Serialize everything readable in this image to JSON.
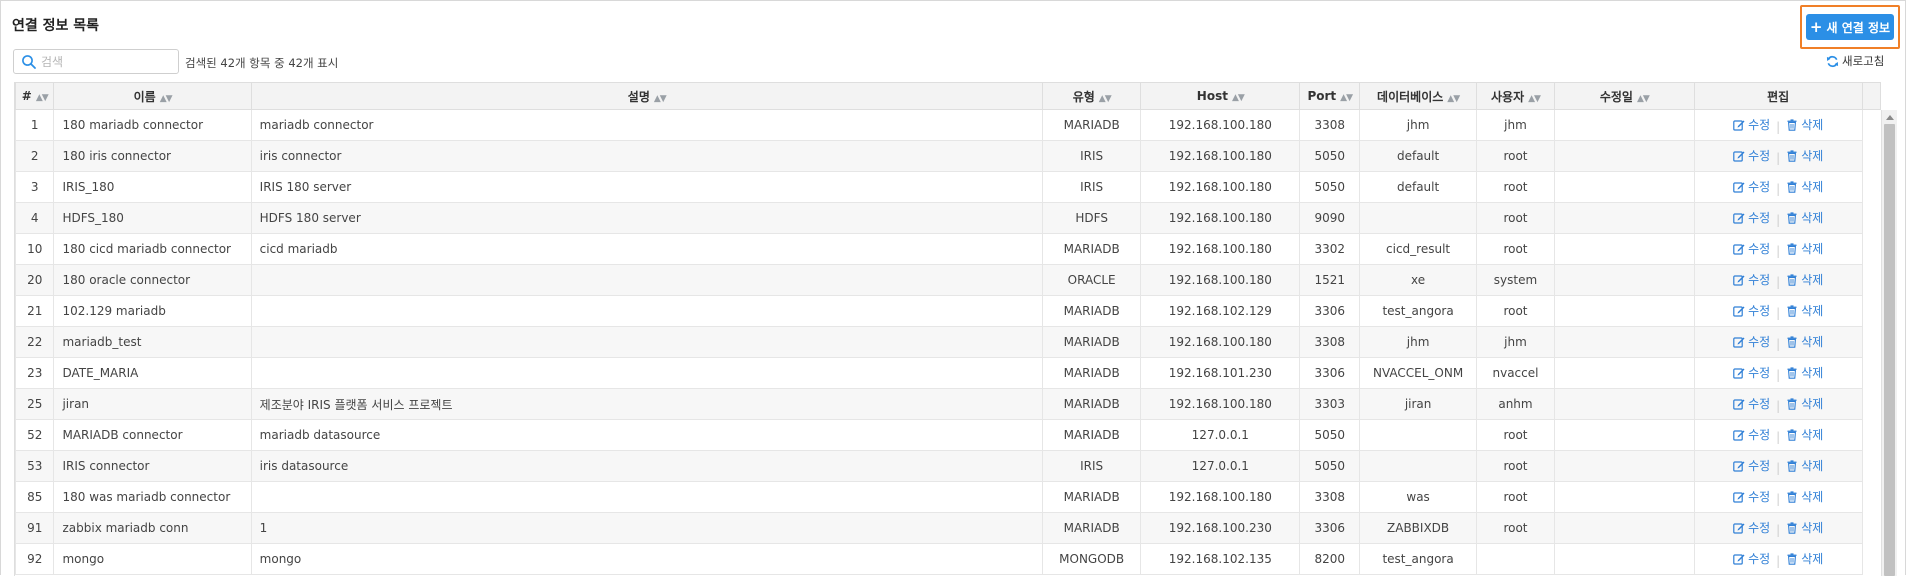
{
  "header": {
    "title": "연결 정보 목록",
    "new_button_label": "새 연결 정보"
  },
  "search": {
    "placeholder": "검색",
    "value": "",
    "result_text": "검색된 42개 항목 중 42개 표시"
  },
  "refresh_label": "새로고침",
  "colors": {
    "accent": "#2b8fe6",
    "highlight_border": "#f07f27",
    "link": "#2f7fd6"
  },
  "table": {
    "columns": [
      "#",
      "이름",
      "설명",
      "유형",
      "Host",
      "Port",
      "데이터베이스",
      "사용자",
      "수정일",
      "편집"
    ],
    "edit_label": "수정",
    "delete_label": "삭제",
    "rows": [
      {
        "id": "1",
        "name": "180 mariadb connector",
        "desc": "mariadb connector",
        "type": "MARIADB",
        "host": "192.168.100.180",
        "port": "3308",
        "db": "jhm",
        "user": "jhm",
        "modified": ""
      },
      {
        "id": "2",
        "name": "180 iris connector",
        "desc": "iris connector",
        "type": "IRIS",
        "host": "192.168.100.180",
        "port": "5050",
        "db": "default",
        "user": "root",
        "modified": ""
      },
      {
        "id": "3",
        "name": "IRIS_180",
        "desc": "IRIS 180 server",
        "type": "IRIS",
        "host": "192.168.100.180",
        "port": "5050",
        "db": "default",
        "user": "root",
        "modified": ""
      },
      {
        "id": "4",
        "name": "HDFS_180",
        "desc": "HDFS 180 server",
        "type": "HDFS",
        "host": "192.168.100.180",
        "port": "9090",
        "db": "",
        "user": "root",
        "modified": ""
      },
      {
        "id": "10",
        "name": "180 cicd mariadb connector",
        "desc": "cicd mariadb",
        "type": "MARIADB",
        "host": "192.168.100.180",
        "port": "3302",
        "db": "cicd_result",
        "user": "root",
        "modified": ""
      },
      {
        "id": "20",
        "name": "180 oracle connector",
        "desc": "",
        "type": "ORACLE",
        "host": "192.168.100.180",
        "port": "1521",
        "db": "xe",
        "user": "system",
        "modified": ""
      },
      {
        "id": "21",
        "name": "102.129 mariadb",
        "desc": "",
        "type": "MARIADB",
        "host": "192.168.102.129",
        "port": "3306",
        "db": "test_angora",
        "user": "root",
        "modified": ""
      },
      {
        "id": "22",
        "name": "mariadb_test",
        "desc": "",
        "type": "MARIADB",
        "host": "192.168.100.180",
        "port": "3308",
        "db": "jhm",
        "user": "jhm",
        "modified": ""
      },
      {
        "id": "23",
        "name": "DATE_MARIA",
        "desc": "",
        "type": "MARIADB",
        "host": "192.168.101.230",
        "port": "3306",
        "db": "NVACCEL_ONM",
        "user": "nvaccel",
        "modified": ""
      },
      {
        "id": "25",
        "name": "jiran",
        "desc": "제조분야 IRIS 플랫폼 서비스 프로젝트",
        "type": "MARIADB",
        "host": "192.168.100.180",
        "port": "3303",
        "db": "jiran",
        "user": "anhm",
        "modified": ""
      },
      {
        "id": "52",
        "name": "MARIADB connector",
        "desc": "mariadb datasource",
        "type": "MARIADB",
        "host": "127.0.0.1",
        "port": "5050",
        "db": "",
        "user": "root",
        "modified": ""
      },
      {
        "id": "53",
        "name": "IRIS connector",
        "desc": "iris datasource",
        "type": "IRIS",
        "host": "127.0.0.1",
        "port": "5050",
        "db": "",
        "user": "root",
        "modified": ""
      },
      {
        "id": "85",
        "name": "180 was mariadb connector",
        "desc": "",
        "type": "MARIADB",
        "host": "192.168.100.180",
        "port": "3308",
        "db": "was",
        "user": "root",
        "modified": ""
      },
      {
        "id": "91",
        "name": "zabbix mariadb conn",
        "desc": "1",
        "type": "MARIADB",
        "host": "192.168.100.230",
        "port": "3306",
        "db": "ZABBIXDB",
        "user": "root",
        "modified": ""
      },
      {
        "id": "92",
        "name": "mongo",
        "desc": "mongo",
        "type": "MONGODB",
        "host": "192.168.102.135",
        "port": "8200",
        "db": "test_angora",
        "user": "",
        "modified": ""
      }
    ]
  }
}
